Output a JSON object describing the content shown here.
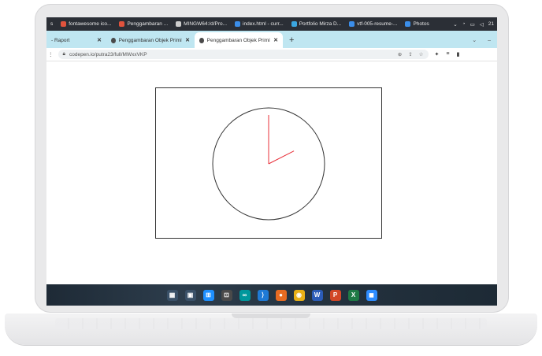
{
  "top_strip": {
    "items": [
      {
        "label": "s",
        "color": "#2b2f36"
      },
      {
        "label": "fontawesome ico...",
        "color": "#e0533d"
      },
      {
        "label": "Penggambaran ...",
        "color": "#e0533d"
      },
      {
        "label": "MINGW64:/d/Pro...",
        "color": "#cccccc"
      },
      {
        "label": "index.html - curr...",
        "color": "#3b8eea"
      },
      {
        "label": "Portfolio Mirza D...",
        "color": "#3ba7e0"
      },
      {
        "label": "vtf-005-resume-...",
        "color": "#3b8eea"
      },
      {
        "label": "Photos",
        "color": "#3b8eea"
      }
    ],
    "right": {
      "chevron": "⌄",
      "tray": "21"
    }
  },
  "tabs": [
    {
      "label": "- Raport",
      "active": false
    },
    {
      "label": "Penggambaran Objek Primitif (Li...",
      "active": false
    },
    {
      "label": "Penggambaran Objek Primitif (Li...",
      "active": true
    }
  ],
  "new_tab": "+",
  "tabs_right": {
    "chevron": "⌄",
    "minimize": "–"
  },
  "address": {
    "nav": "⋮",
    "url": "codepen.io/putra23/full/MWxxVKP"
  },
  "clock": {
    "hour_angle_deg": 63,
    "minute_angle_deg": 0,
    "hand_color": "#e8303a",
    "face_color": "#333333"
  },
  "taskbar_icons": [
    {
      "name": "task-view-icon",
      "glyph": "▦",
      "bg": "#3a5168"
    },
    {
      "name": "widgets-icon",
      "glyph": "▣",
      "bg": "#3a5168"
    },
    {
      "name": "windows-start-icon",
      "glyph": "⊞",
      "bg": "#1e90ff"
    },
    {
      "name": "terminal-icon",
      "glyph": "⊡",
      "bg": "#4a4a4a"
    },
    {
      "name": "arduino-icon",
      "glyph": "∞",
      "bg": "#00979c"
    },
    {
      "name": "vscode-icon",
      "glyph": "⟩",
      "bg": "#1f7ad6"
    },
    {
      "name": "firefox-icon",
      "glyph": "●",
      "bg": "#e86b22"
    },
    {
      "name": "chrome-icon",
      "glyph": "◉",
      "bg": "#e8b017"
    },
    {
      "name": "word-icon",
      "glyph": "W",
      "bg": "#2b5cb8"
    },
    {
      "name": "powerpoint-icon",
      "glyph": "P",
      "bg": "#d24726"
    },
    {
      "name": "excel-icon",
      "glyph": "X",
      "bg": "#1f7a45"
    },
    {
      "name": "zoom-icon",
      "glyph": "◼",
      "bg": "#2d8cff"
    }
  ]
}
